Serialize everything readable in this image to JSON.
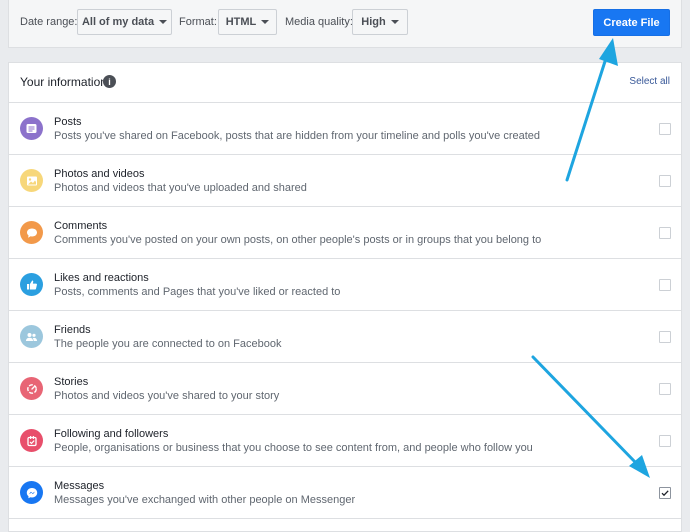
{
  "toolbar": {
    "date_range_label": "Date range:",
    "date_range_value": "All of my data",
    "format_label": "Format:",
    "format_value": "HTML",
    "quality_label": "Media quality:",
    "quality_value": "High",
    "create_button": "Create File"
  },
  "panel": {
    "title": "Your information",
    "info_icon": "i",
    "select_all": "Select all"
  },
  "rows": [
    {
      "title": "Posts",
      "desc": "Posts you've shared on Facebook, posts that are hidden from your timeline and polls you've created",
      "icon": "posts-icon",
      "color": "#8c72cb",
      "checked": false
    },
    {
      "title": "Photos and videos",
      "desc": "Photos and videos that you've uploaded and shared",
      "icon": "photos-icon",
      "color": "#f7d77a",
      "checked": false
    },
    {
      "title": "Comments",
      "desc": "Comments you've posted on your own posts, on other people's posts or in groups that you belong to",
      "icon": "comments-icon",
      "color": "#f2994a",
      "checked": false
    },
    {
      "title": "Likes and reactions",
      "desc": "Posts, comments and Pages that you've liked or reacted to",
      "icon": "likes-icon",
      "color": "#2abba7",
      "checked": false
    },
    {
      "title": "Friends",
      "desc": "The people you are connected to on Facebook",
      "icon": "friends-icon",
      "color": "#9cc7dd",
      "checked": false
    },
    {
      "title": "Stories",
      "desc": "Photos and videos you've shared to your story",
      "icon": "stories-icon",
      "color": "#e86575",
      "checked": false
    },
    {
      "title": "Following and followers",
      "desc": "People, organisations or business that you choose to see content from, and people who follow you",
      "icon": "following-icon",
      "color": "#e84f6b",
      "checked": false
    },
    {
      "title": "Messages",
      "desc": "Messages you've exchanged with other people on Messenger",
      "icon": "messenger-icon",
      "color": "#1877f2",
      "checked": true
    }
  ],
  "annotation_color": "#1ea5e0"
}
